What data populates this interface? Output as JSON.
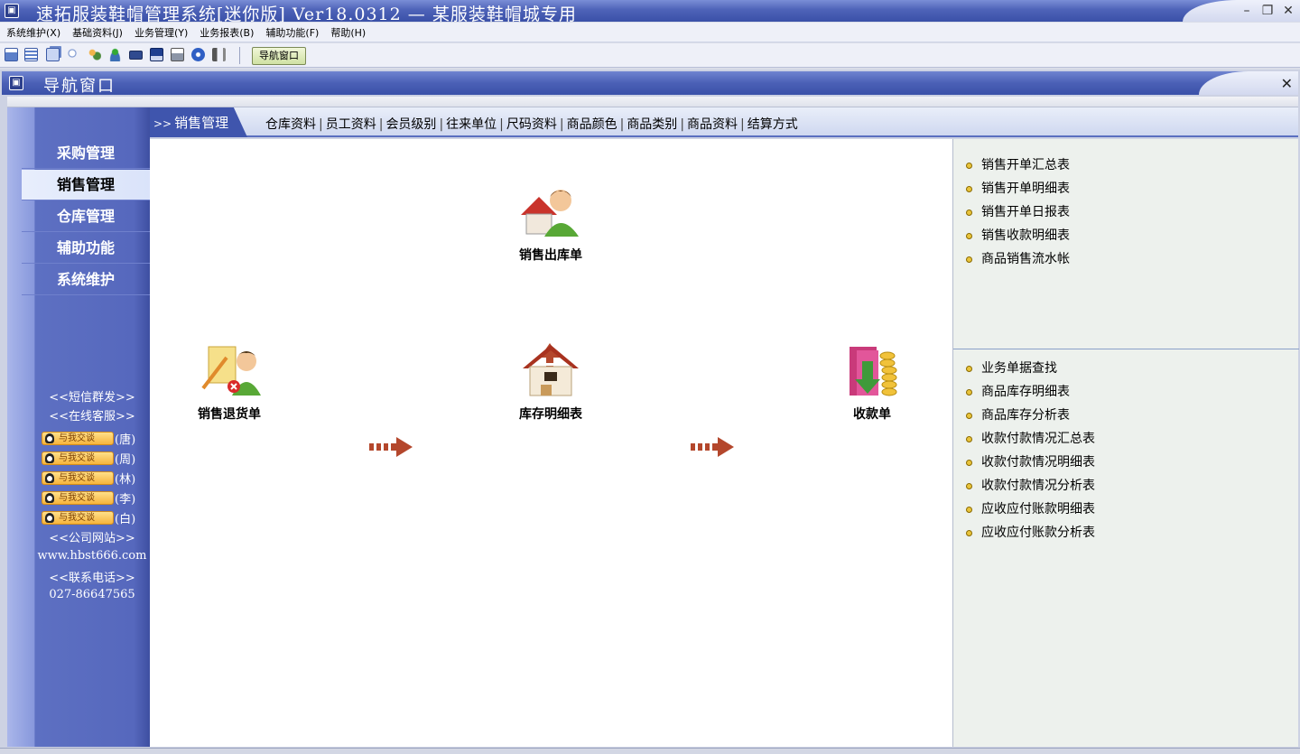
{
  "app": {
    "title": "速拓服装鞋帽管理系统[迷你版] Ver18.0312 — 某服装鞋帽城专用",
    "window_buttons": {
      "minimize": "–",
      "restore": "❐",
      "close": "✕"
    }
  },
  "menu": [
    "系统维护(X)",
    "基础资料(J)",
    "业务管理(Y)",
    "业务报表(B)",
    "辅助功能(F)",
    "帮助(H)"
  ],
  "toolbar": {
    "nav_button": "导航窗口",
    "icons": [
      "grid-icon",
      "list-icon",
      "window-icon",
      "search-icon",
      "users-icon",
      "user-icon",
      "card-icon",
      "save-icon",
      "print-icon",
      "help-icon",
      "exit-icon"
    ]
  },
  "inner_window": {
    "title": "导航窗口",
    "close": "✕"
  },
  "left_nav": {
    "items": [
      "采购管理",
      "销售管理",
      "仓库管理",
      "辅助功能",
      "系统维护"
    ],
    "active_index": 1,
    "sms": "<<短信群发>>",
    "service": "<<在线客服>>",
    "qq_label": "与我交谈",
    "qq_contacts": [
      "(唐)",
      "(周)",
      "(林)",
      "(李)",
      "(白)"
    ],
    "site_title": "<<公司网站>>",
    "site_url": "www.hbst666.com",
    "phone_title": "<<联系电话>>",
    "phone": "027-86647565"
  },
  "tabbar": {
    "active_prefix": ">>",
    "active": "销售管理",
    "tabs": [
      "仓库资料",
      "员工资料",
      "会员级别",
      "往来单位",
      "尺码资料",
      "商品颜色",
      "商品类别",
      "商品资料",
      "结算方式"
    ]
  },
  "flow": {
    "sales_out": "销售出库单",
    "sales_return": "销售退货单",
    "inventory": "库存明细表",
    "receipt": "收款单"
  },
  "reports": {
    "group1": [
      "销售开单汇总表",
      "销售开单明细表",
      "销售开单日报表",
      "销售收款明细表",
      "商品销售流水帐"
    ],
    "group2": [
      "业务单据查找",
      "商品库存明细表",
      "商品库存分析表",
      "收款付款情况汇总表",
      "收款付款情况明细表",
      "收款付款情况分析表",
      "应收应付账款明细表",
      "应收应付账款分析表"
    ]
  },
  "colors": {
    "title_blue": "#3a50a8",
    "nav_blue": "#5668bd",
    "arrow_brown": "#a0442a",
    "panel_green": "#edf1ed"
  }
}
